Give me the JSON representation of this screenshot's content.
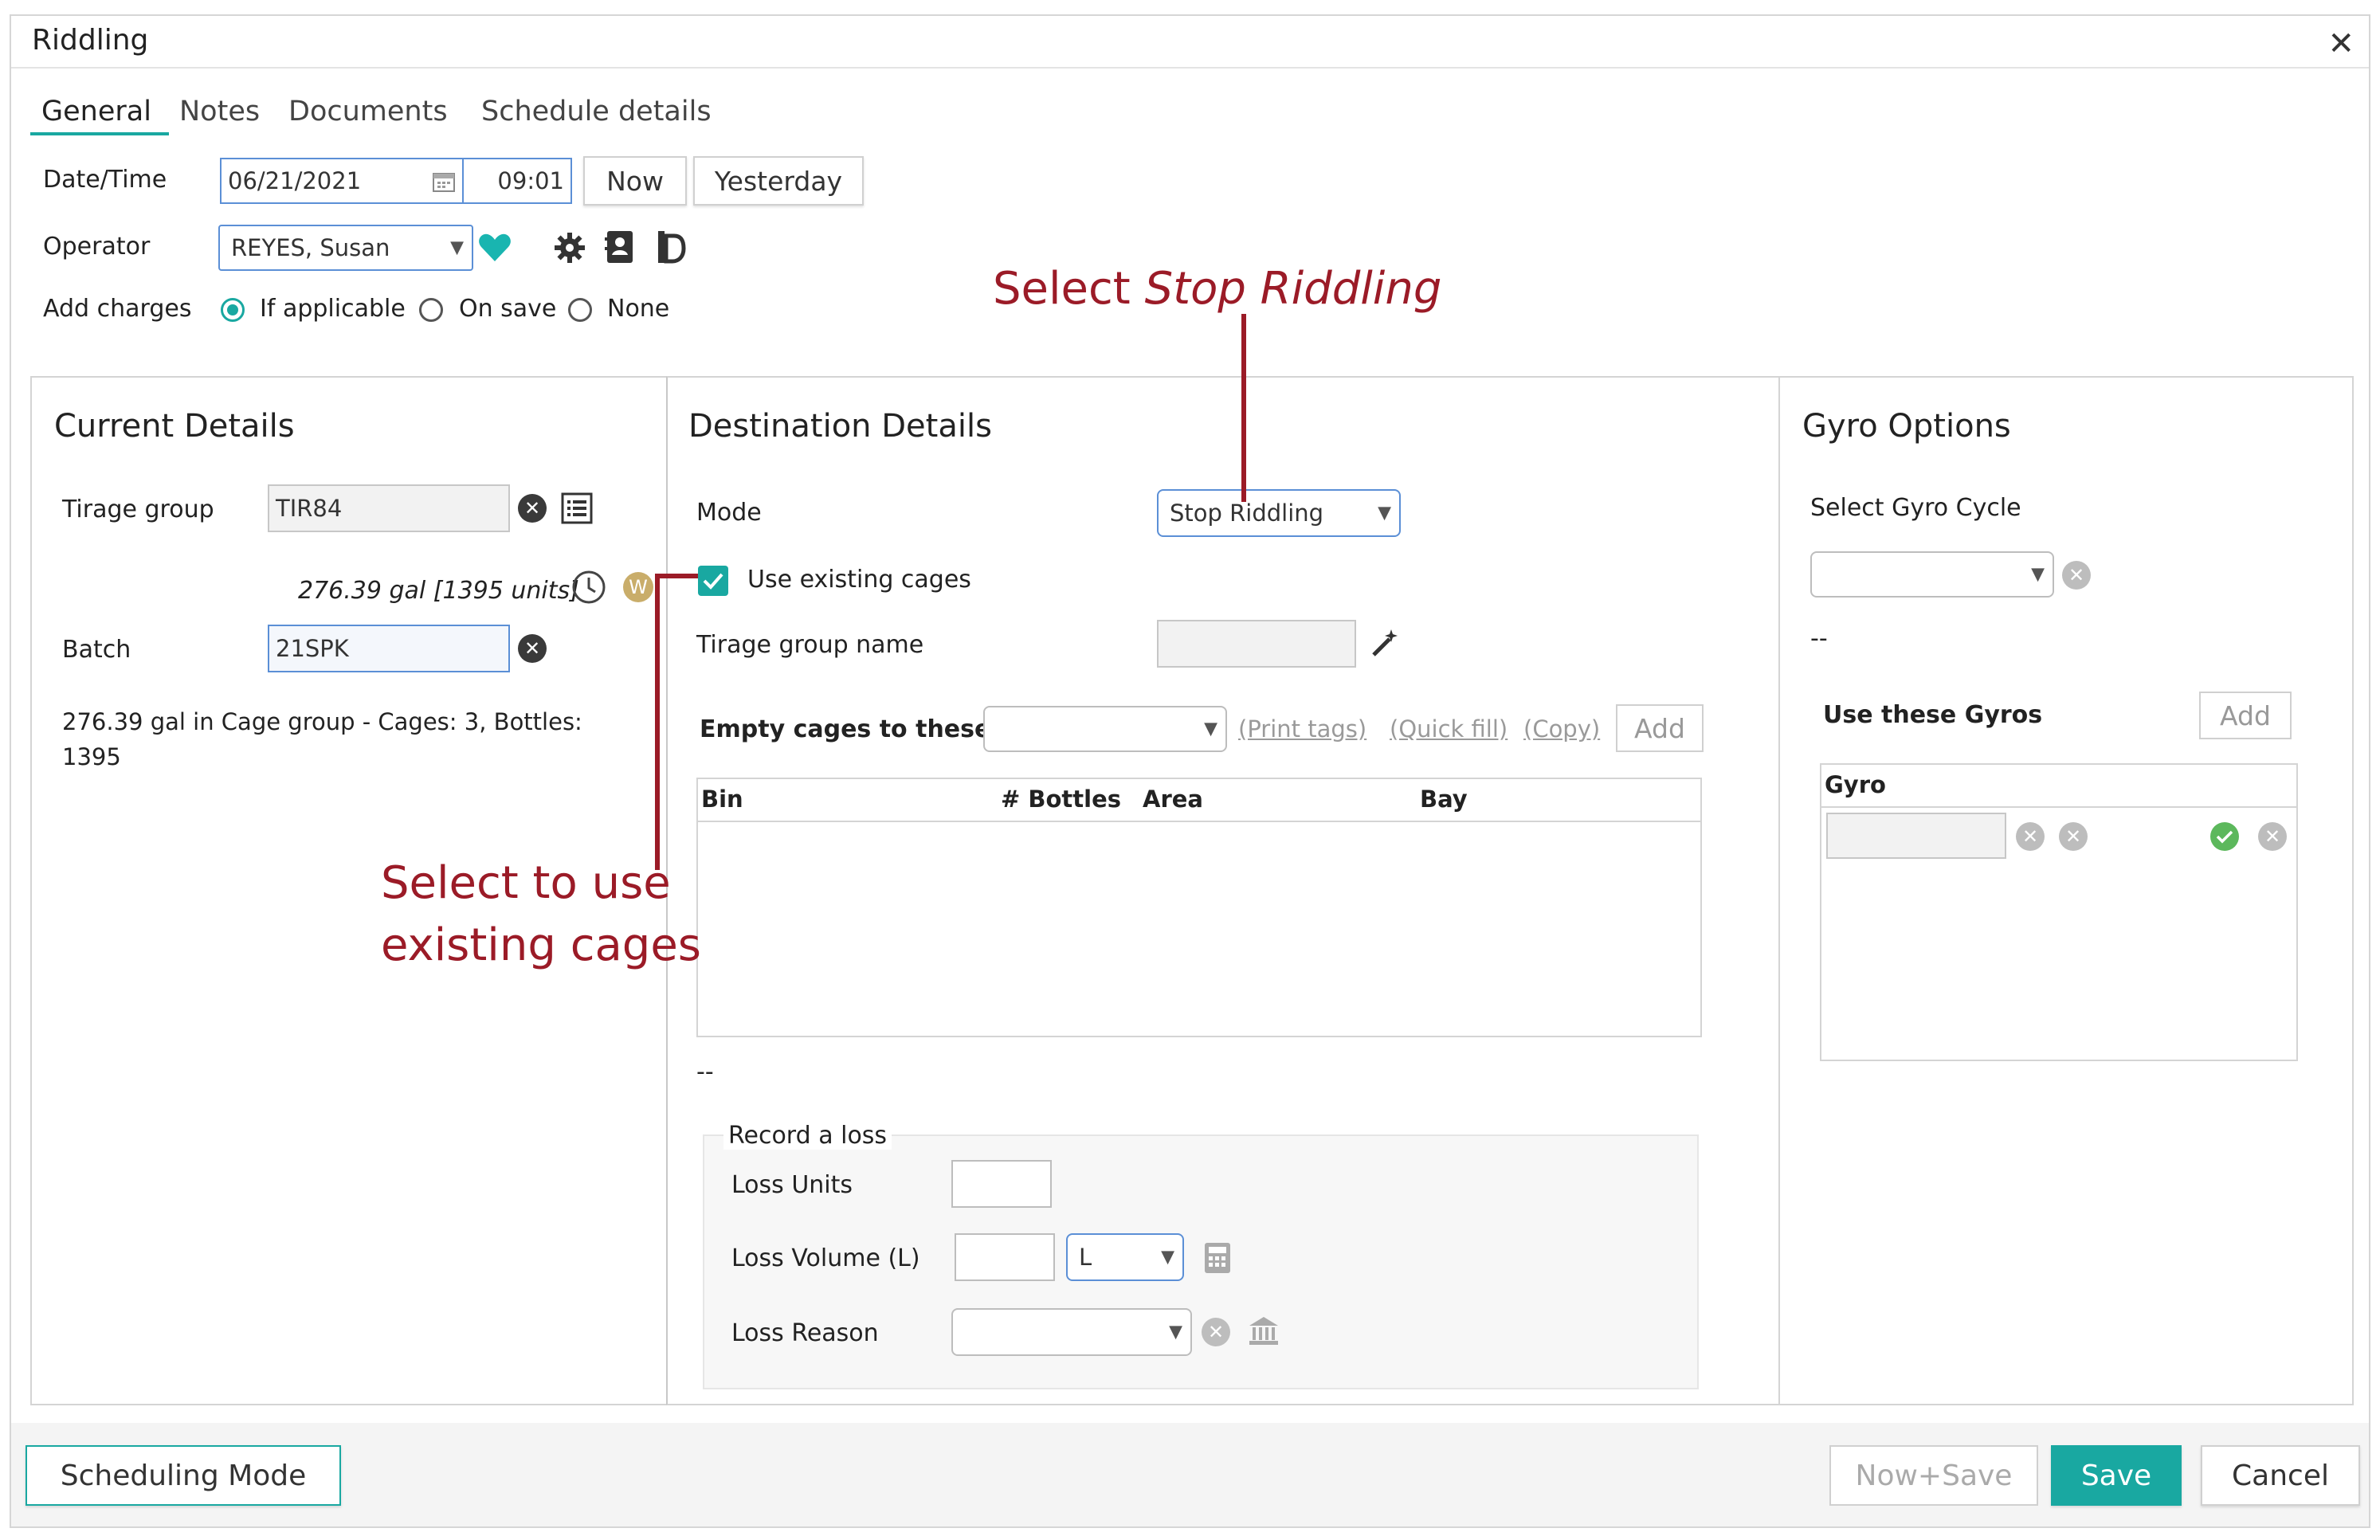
{
  "dialog": {
    "title": "Riddling",
    "close_glyph": "✕"
  },
  "tabs": [
    {
      "label": "General"
    },
    {
      "label": "Notes"
    },
    {
      "label": "Documents"
    },
    {
      "label": "Schedule details"
    }
  ],
  "header": {
    "datetime_label": "Date/Time",
    "date_value": "06/21/2021",
    "time_value": "09:01",
    "now_label": "Now",
    "yesterday_label": "Yesterday",
    "operator_label": "Operator",
    "operator_value": "REYES, Susan",
    "add_charges_label": "Add charges",
    "charges_options": [
      "If applicable",
      "On save",
      "None"
    ],
    "charges_selected": "If applicable"
  },
  "current": {
    "title": "Current Details",
    "tirage_label": "Tirage group",
    "tirage_value": "TIR84",
    "volume_text": "276.39 gal [1395 units]",
    "w_badge": "W",
    "batch_label": "Batch",
    "batch_value": "21SPK",
    "summary": "276.39 gal in Cage group - Cages: 3, Bottles: 1395"
  },
  "destination": {
    "title": "Destination Details",
    "mode_label": "Mode",
    "mode_value": "Stop Riddling",
    "use_existing_label": "Use existing cages",
    "use_existing_checked": true,
    "tirage_name_label": "Tirage group name",
    "empty_cages_label": "Empty cages to these",
    "print_tags": "(Print tags)",
    "quick_fill": "(Quick fill)",
    "copy": "(Copy)",
    "add_label": "Add",
    "grid_columns": [
      "Bin",
      "# Bottles",
      "Area",
      "Bay"
    ],
    "grid_footer": "--",
    "loss": {
      "legend": "Record a loss",
      "units_label": "Loss Units",
      "volume_label": "Loss Volume (L)",
      "volume_unit": "L",
      "reason_label": "Loss Reason"
    }
  },
  "gyro": {
    "title": "Gyro Options",
    "cycle_label": "Select Gyro Cycle",
    "cycle_footer": "--",
    "use_label": "Use these Gyros",
    "add_label": "Add",
    "column": "Gyro"
  },
  "footer": {
    "scheduling_label": "Scheduling Mode",
    "now_save_label": "Now+Save",
    "save_label": "Save",
    "cancel_label": "Cancel"
  },
  "annotations": {
    "stop_prefix": "Select ",
    "stop_italic": "Stop Riddling",
    "cages_line1": "Select to use",
    "cages_line2": "existing cages"
  },
  "colors": {
    "accent": "#19a8a1",
    "annotation": "#9b1b27",
    "input_border_active": "#5b8fd6",
    "favorite": "#19b5b0"
  }
}
